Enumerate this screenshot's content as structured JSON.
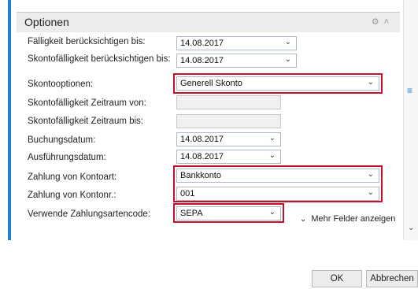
{
  "panel": {
    "title": "Optionen"
  },
  "fields": [
    {
      "label": "Fälligkeit berücksichtigen bis:",
      "value": "14.08.2017"
    },
    {
      "label": "Skontofälligkeit berücksichtigen bis:",
      "value": "14.08.2017"
    },
    {
      "label": "Skontooptionen:",
      "value": "Generell Skonto"
    },
    {
      "label": "Skontofälligkeit Zeitraum von:",
      "value": ""
    },
    {
      "label": "Skontofälligkeit Zeitraum bis:",
      "value": ""
    },
    {
      "label": "Buchungsdatum:",
      "value": "14.08.2017"
    },
    {
      "label": "Ausführungsdatum:",
      "value": "14.08.2017"
    },
    {
      "label": "Zahlung von Kontoart:",
      "value": "Bankkonto"
    },
    {
      "label": "Zahlung von Kontonr.:",
      "value": "001"
    },
    {
      "label": "Verwende Zahlungsartencode:",
      "value": "SEPA"
    }
  ],
  "more_fields": {
    "label": "Mehr Felder anzeigen"
  },
  "buttons": {
    "ok": "OK",
    "cancel": "Abbrechen"
  },
  "colors": {
    "accent": "#1f7fd0",
    "highlight": "#c8102e"
  }
}
